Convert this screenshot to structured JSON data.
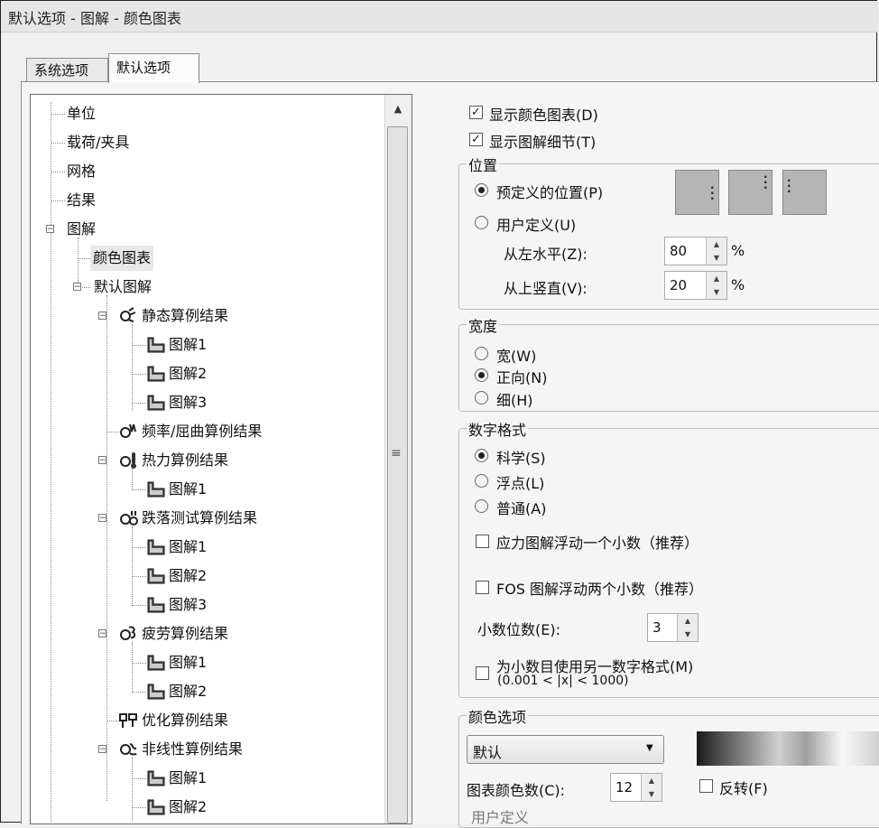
{
  "window": {
    "title": "默认选项 - 图解 - 颜色图表"
  },
  "tabs": [
    {
      "label": "系统选项",
      "active": false
    },
    {
      "label": "默认选项",
      "active": true
    }
  ],
  "tree": {
    "units": "单位",
    "loads": "载荷/夹具",
    "mesh": "网格",
    "results": "结果",
    "plot": "图解",
    "color_chart": "颜色图表",
    "default_plot": "默认图解",
    "static": "静态算例结果",
    "static_children": [
      "图解1",
      "图解2",
      "图解3"
    ],
    "frequency": "频率/屈曲算例结果",
    "thermal": "热力算例结果",
    "thermal_children": [
      "图解1"
    ],
    "drop": "跌落测试算例结果",
    "drop_children": [
      "图解1",
      "图解2",
      "图解3"
    ],
    "fatigue": "疲劳算例结果",
    "fatigue_children": [
      "图解1",
      "图解2"
    ],
    "optimization": "优化算例结果",
    "nonlinear": "非线性算例结果",
    "nonlinear_children": [
      "图解1",
      "图解2"
    ]
  },
  "options": {
    "show_color_chart": "显示颜色图表(D)",
    "show_plot_details": "显示图解细节(T)",
    "position": {
      "title": "位置",
      "predefined": "预定义的位置(P)",
      "user_defined": "用户定义(U)",
      "from_left": "从左水平(Z):",
      "from_left_value": "80",
      "from_top": "从上竖直(V):",
      "from_top_value": "20",
      "unit": "%"
    },
    "width": {
      "title": "宽度",
      "wide": "宽(W)",
      "normal": "正向(N)",
      "thin": "细(H)"
    },
    "number_format": {
      "title": "数字格式",
      "scientific": "科学(S)",
      "floating": "浮点(L)",
      "general": "普通(A)",
      "stress_float": "应力图解浮动一个小数（推荐）",
      "fos_float": "FOS 图解浮动两个小数（推荐）",
      "decimals_label": "小数位数(E):",
      "decimals_value": "3",
      "alt_format_line1": "为小数目使用另一数字格式(M)",
      "alt_format_line2": "(0.001 < |x| < 1000)"
    },
    "color": {
      "title": "颜色选项",
      "scheme": "默认",
      "count_label": "图表颜色数(C):",
      "count_value": "12",
      "reverse": "反转(F)",
      "user_defined": "用户定义"
    }
  }
}
